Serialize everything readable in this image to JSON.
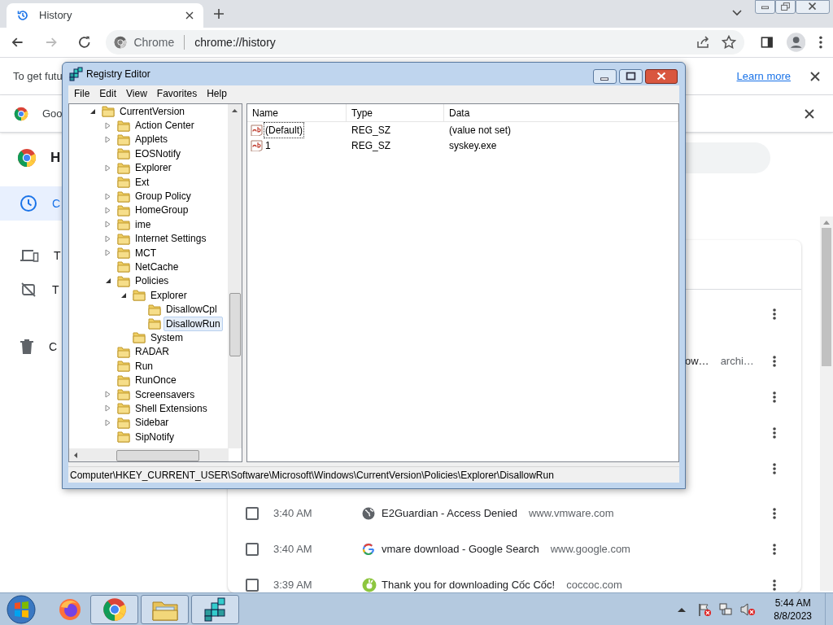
{
  "browser": {
    "tab": {
      "title": "History"
    },
    "omnibox": {
      "chip": "Chrome",
      "url": "chrome://history"
    }
  },
  "infobar": {
    "text": "To get futu",
    "link": "Learn more"
  },
  "banner": {
    "text": "Goo"
  },
  "page": {
    "heading": "H"
  },
  "sidebar": {
    "items": [
      {
        "kind": "clock",
        "label": "C",
        "selected": true
      },
      {
        "kind": "devices",
        "label": "T",
        "selected": false
      },
      {
        "kind": "tabs-off",
        "label": "T",
        "selected": false
      },
      {
        "kind": "trash",
        "label": "C",
        "selected": false
      }
    ]
  },
  "history": {
    "groups": [
      {
        "rows": [
          {
            "kind": "covered"
          }
        ]
      },
      {
        "rows": [
          {
            "kind": "partial",
            "title": "ow…",
            "domain": "archi…"
          },
          {
            "kind": "covered"
          },
          {
            "kind": "covered"
          },
          {
            "kind": "covered"
          }
        ]
      },
      {
        "rows": [
          {
            "kind": "full",
            "checked": false,
            "time": "3:40 AM",
            "favicon": {
              "kind": "globe"
            },
            "title": "E2Guardian - Access Denied",
            "domain": "www.vmware.com"
          },
          {
            "kind": "full",
            "checked": false,
            "time": "3:40 AM",
            "favicon": {
              "kind": "google"
            },
            "title": "vmare download - Google Search",
            "domain": "www.google.com"
          },
          {
            "kind": "full",
            "checked": false,
            "time": "3:39 AM",
            "favicon": {
              "kind": "coccoc"
            },
            "title": "Thank you for downloading Cốc Cốc!",
            "domain": "coccoc.com"
          }
        ]
      }
    ]
  },
  "regedit": {
    "title": "Registry Editor",
    "menu": [
      "File",
      "Edit",
      "View",
      "Favorites",
      "Help"
    ],
    "tree": [
      {
        "label": "CurrentVersion",
        "expanded": true,
        "selected": false,
        "children": [
          {
            "label": "Action Center",
            "expanded": false,
            "selected": false
          },
          {
            "label": "Applets",
            "expanded": false,
            "selected": false
          },
          {
            "label": "EOSNotify",
            "selected": false
          },
          {
            "label": "Explorer",
            "expanded": false,
            "selected": false
          },
          {
            "label": "Ext",
            "selected": false
          },
          {
            "label": "Group Policy",
            "expanded": false,
            "selected": false
          },
          {
            "label": "HomeGroup",
            "expanded": false,
            "selected": false
          },
          {
            "label": "ime",
            "expanded": false,
            "selected": false
          },
          {
            "label": "Internet Settings",
            "expanded": false,
            "selected": false
          },
          {
            "label": "MCT",
            "expanded": false,
            "selected": false
          },
          {
            "label": "NetCache",
            "selected": false
          },
          {
            "label": "Policies",
            "expanded": true,
            "selected": false,
            "children": [
              {
                "label": "Explorer",
                "expanded": true,
                "selected": false,
                "children": [
                  {
                    "label": "DisallowCpl",
                    "selected": false
                  },
                  {
                    "label": "DisallowRun",
                    "selected": true
                  }
                ]
              },
              {
                "label": "System",
                "selected": false
              }
            ]
          },
          {
            "label": "RADAR",
            "selected": false
          },
          {
            "label": "Run",
            "selected": false
          },
          {
            "label": "RunOnce",
            "selected": false
          },
          {
            "label": "Screensavers",
            "expanded": false,
            "selected": false
          },
          {
            "label": "Shell Extensions",
            "expanded": false,
            "selected": false
          },
          {
            "label": "Sidebar",
            "expanded": false,
            "selected": false
          },
          {
            "label": "SipNotify",
            "selected": false
          }
        ]
      }
    ],
    "list": {
      "columns": [
        "Name",
        "Type",
        "Data"
      ],
      "rows": [
        {
          "name": "(Default)",
          "type": "REG_SZ",
          "data": "(value not set)",
          "focused": true
        },
        {
          "name": "1",
          "type": "REG_SZ",
          "data": "syskey.exe",
          "focused": false
        }
      ]
    },
    "status": "Computer\\HKEY_CURRENT_USER\\Software\\Microsoft\\Windows\\CurrentVersion\\Policies\\Explorer\\DisallowRun"
  },
  "taskbar": {
    "apps": [
      {
        "kind": "firefox",
        "running": false
      },
      {
        "kind": "chrome",
        "running": true
      },
      {
        "kind": "explorer",
        "running": true
      },
      {
        "kind": "regedit",
        "running": true
      }
    ],
    "clock": {
      "time": "5:44 AM",
      "date": "8/8/2023"
    }
  }
}
